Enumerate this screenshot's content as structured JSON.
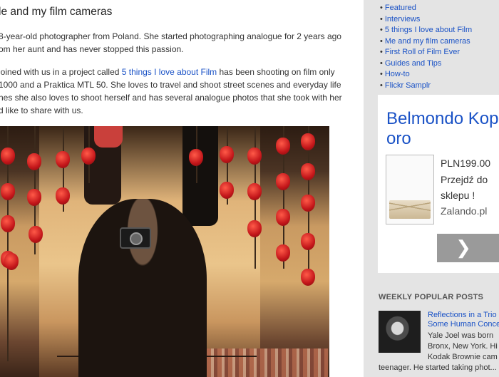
{
  "post": {
    "title": "le and my film cameras",
    "para1": [
      "8-year-old photographer from Poland. She started photographing analogue for 2 years ago",
      "om her aunt and has never stopped this passion."
    ],
    "para2_line1_pre": "joined with us in a project called ",
    "para2_link": "5 things I love about Film",
    "para2_line1_post": " has been shooting on film only",
    "para2_rest": [
      "1000 and a Praktica MTL 50. She loves to travel and shoot street scenes and everyday life",
      "nes she also loves to shoot herself and has several analogue photos that she took with her",
      "d like to share with us."
    ]
  },
  "sidebar": {
    "links": [
      "Featured",
      "Interviews",
      "5 things I love about Film",
      "Me and my film cameras",
      "First Roll of Film Ever",
      "Guides and Tips",
      "How-to",
      "Flickr Samplr"
    ],
    "bullet": "•"
  },
  "ad": {
    "title_lines": [
      "Belmondo Kop",
      "oro"
    ],
    "price": "PLN199.00",
    "cta_lines": [
      "Przejdź do",
      "sklepu !"
    ],
    "brand": "Zalando.pl",
    "button_icon": "chevron-right-icon",
    "button_glyph": "❯"
  },
  "weekly_popular": {
    "heading": "WEEKLY POPULAR POSTS",
    "post_title_lines": [
      "Reflections in a Trio",
      "Some Human Conce"
    ],
    "snippet_lines": [
      "Yale Joel was born",
      "Bronx, New York. Hi",
      "Kodak Brownie cam"
    ],
    "snippet_last": "teenager. He started taking phot..."
  },
  "colors": {
    "link": "#1a52c6",
    "sidebar_bg": "#e4e4e4",
    "ad_button": "#9a9a9a"
  }
}
